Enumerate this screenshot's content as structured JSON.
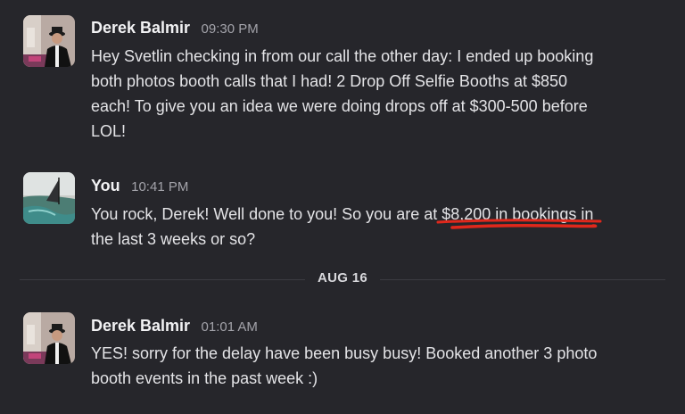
{
  "colors": {
    "background": "#26262b",
    "annotation_underline": "#e0281c"
  },
  "messages": [
    {
      "sender": "Derek Balmir",
      "time": "09:30 PM",
      "avatar": "avatar-photo-man-in-hat",
      "lines": [
        "Hey Svetlin checking in from our call the other day: I ended up booking",
        "both photos booth calls that I had! 2 Drop Off Selfie Booths at $850",
        "each! To give you an idea we were doing drops off at $300-500 before",
        "LOL!"
      ]
    },
    {
      "sender": "You",
      "time": "10:41 PM",
      "avatar": "avatar-photo-windsurfer",
      "line1_before": "You rock, Derek! Well done to you! So you are at ",
      "line1_highlight": "$8,200 in bookings",
      "line1_after": " in",
      "line2": "the last 3 weeks or so?"
    },
    {
      "sender": "Derek Balmir",
      "time": "01:01 AM",
      "avatar": "avatar-photo-man-in-hat",
      "lines": [
        "YES! sorry for the delay have been busy busy! Booked another 3 photo",
        "booth events in the past week :)"
      ]
    }
  ],
  "date_divider": "AUG 16"
}
